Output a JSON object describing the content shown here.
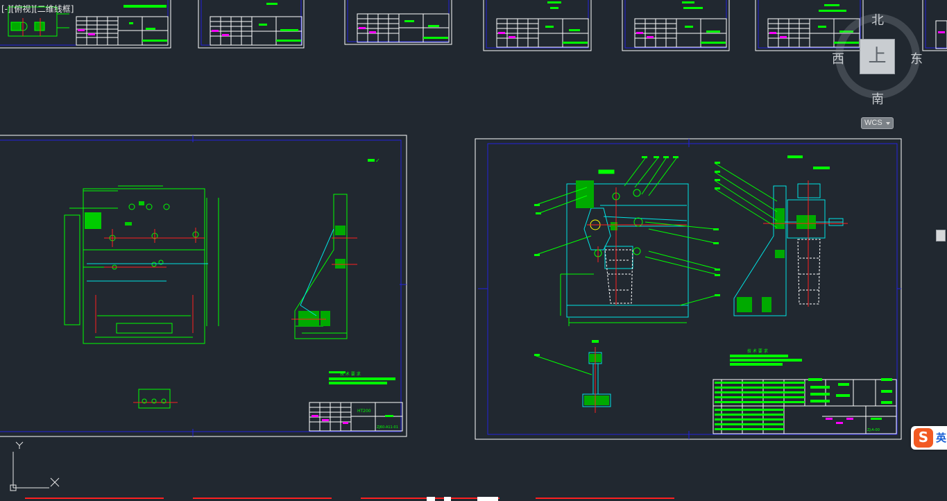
{
  "viewport_label": {
    "prefix": "[-]",
    "view": "[俯视]",
    "style": "[二维线框]"
  },
  "view_cube": {
    "north": "北",
    "south": "南",
    "east": "东",
    "west": "西",
    "top_face": "上"
  },
  "wcs_menu": {
    "label": "WCS"
  },
  "ucs_icon": {
    "x_label": "X",
    "y_label": "Y"
  },
  "ime_indicator": {
    "logo": "S",
    "mode": "英"
  },
  "sheets": {
    "thumb_1": {
      "title_text": "技术要求",
      "part_name": "20",
      "material": "V形块",
      "drawing_no": "ZJ60-A11-02"
    },
    "thumb_2": {
      "part_name": "T10A",
      "material": "模 B",
      "drawing_no": "ZJ60-A11-03"
    },
    "thumb_3": {
      "part_name": "45GOA",
      "material": "垫 圈",
      "drawing_no": "ZJ60-A11-04"
    },
    "thumb_4": {
      "part_name": "45",
      "material": "支撑 六角螺母",
      "drawing_no": "ZJ60-A11-05"
    },
    "thumb_5": {
      "part_name": "45",
      "material": "定位块1",
      "drawing_no": "ZJ60-A11-06"
    },
    "thumb_6": {
      "title_text": "技术要求",
      "part_name": "45",
      "material": "定位块2",
      "drawing_no": "ZJ60-A11-07"
    },
    "main_left": {
      "roughness_mark": "✓",
      "tech_req_title": "技 术 要 求",
      "part_name": "HT200",
      "material": "夹具体",
      "drawing_no": "ZJ60-A11-01"
    },
    "main_right": {
      "tech_req_title": "技 术 要 求",
      "drawing_no": "ZJ-A-00"
    }
  },
  "colors": {
    "background": "#212830",
    "border_white": "#ffffff",
    "frame_blue": "#2222dd",
    "geometry_green": "#00ff00",
    "geometry_cyan": "#00e5e5",
    "centerline_red": "#ff2020",
    "text_magenta": "#ff00ff",
    "hatch_yellow": "#ffff00"
  }
}
